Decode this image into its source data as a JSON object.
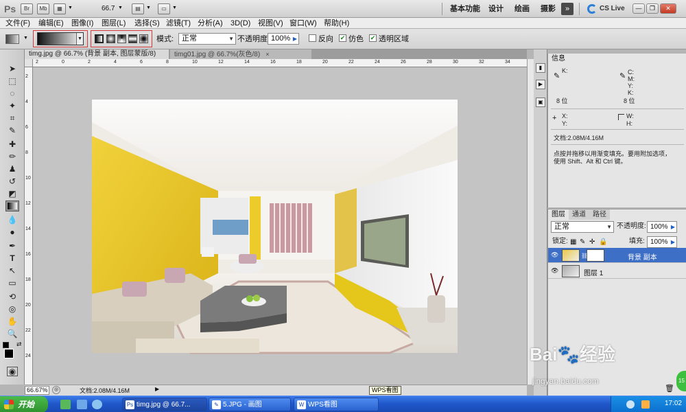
{
  "appbar": {
    "logo": "Ps",
    "br_label": "Br",
    "mb_label": "Mb",
    "zoom": "66.7",
    "workspaces": [
      "基本功能",
      "设计",
      "绘画",
      "摄影"
    ],
    "cs_live": "CS Live"
  },
  "menu": [
    "文件(F)",
    "编辑(E)",
    "图像(I)",
    "图层(L)",
    "选择(S)",
    "滤镜(T)",
    "分析(A)",
    "3D(D)",
    "视图(V)",
    "窗口(W)",
    "帮助(H)"
  ],
  "options": {
    "mode_label": "模式:",
    "mode_value": "正常",
    "opacity_label": "不透明度:",
    "opacity_value": "100%",
    "reverse_label": "反向",
    "dither_label": "仿色",
    "transparency_label": "透明区域"
  },
  "tabs": [
    {
      "label": "timg.jpg @ 66.7% (背景 副本, 图层蒙版/8) *",
      "close": "×"
    },
    {
      "label": "timg01.jpg @ 66.7%(灰色/8)",
      "close": "×"
    }
  ],
  "ruler_top": [
    "2",
    "0",
    "2",
    "4",
    "6",
    "8",
    "10",
    "12",
    "14",
    "16",
    "18",
    "20",
    "22",
    "24",
    "26",
    "28",
    "30",
    "32",
    "34"
  ],
  "ruler_left": [
    "2",
    "4",
    "6",
    "8",
    "10",
    "12",
    "14",
    "16",
    "18",
    "20",
    "22",
    "24"
  ],
  "status": {
    "zoom": "66.67%",
    "doc": "文档:2.08M/4.16M",
    "tooltip": "WPS看图"
  },
  "info_panel": {
    "tab": "信息",
    "k_label": "K:",
    "bit_left": "8 位",
    "c_label": "C:",
    "m_label": "M:",
    "y_label": "Y:",
    "k2_label": "K:",
    "bit_right": "8 位",
    "x_label": "X:",
    "y2_label": "Y:",
    "w_label": "W:",
    "h_label": "H:",
    "doc": "文档:2.08M/4.16M",
    "hint_line1": "点按并拖移以用渐变填充。要用附加选项，",
    "hint_line2": "使用 Shift、Alt 和 Ctrl 键。"
  },
  "layers_panel": {
    "tabs": [
      "图层",
      "通道",
      "路径"
    ],
    "blend_mode": "正常",
    "opacity_label": "不透明度:",
    "opacity_value": "100%",
    "lock_label": "锁定:",
    "fill_label": "填充:",
    "fill_value": "100%",
    "layers": [
      {
        "name": "背景 副本",
        "selected": true
      },
      {
        "name": "图层 1",
        "selected": false
      }
    ]
  },
  "taskbar": {
    "start": "开始",
    "tasks": [
      {
        "label": "timg.jpg @ 66.7..."
      },
      {
        "label": "5.JPG - 画图"
      },
      {
        "label": "WPS看图"
      }
    ],
    "clock": "17:02"
  },
  "watermark": {
    "brand": "Bai",
    "brand2": "经验",
    "url": "jingyan.baidu.com"
  },
  "badge": "15",
  "colors": {
    "selected_layer": "#3d6fc6",
    "taskbar": "#1f56c9",
    "canvas_bg": "#c4c4c4",
    "wall_yellow": "#e8c21c"
  }
}
